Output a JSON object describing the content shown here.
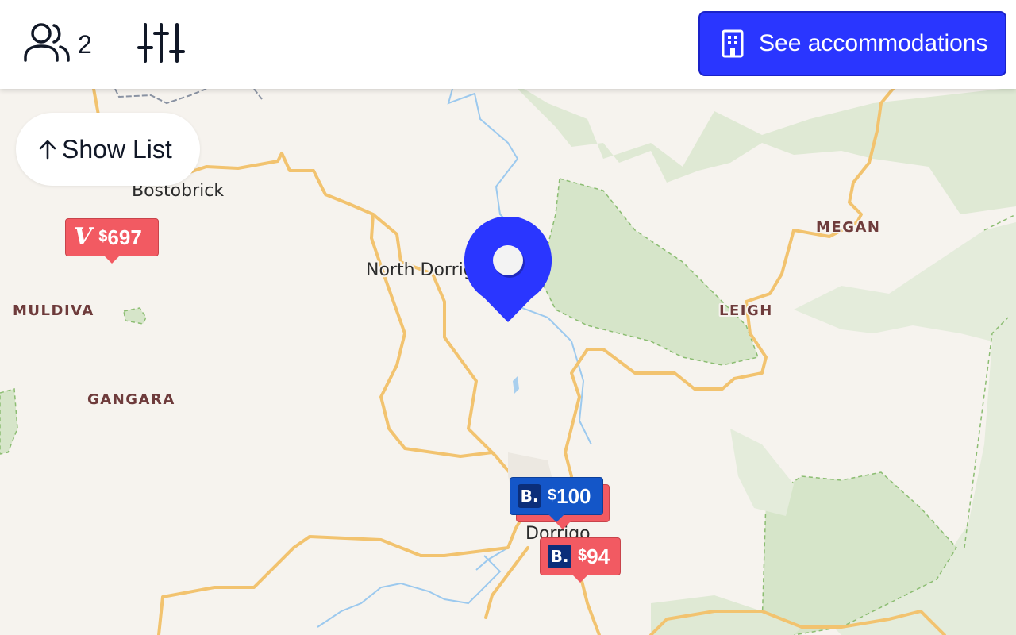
{
  "topbar": {
    "guests_count": "2",
    "cta_label": "See accommodations",
    "colors": {
      "cta": "#2a36ff"
    }
  },
  "show_list": {
    "label": "Show List"
  },
  "map": {
    "places": {
      "bostobrick": "Bostobrick",
      "north_dorrigo": "North Dorrigo",
      "dorrigo": "Dorrigo"
    },
    "localities": {
      "megan": "MEGAN",
      "muldiva": "MULDIVA",
      "leigh": "LEIGH",
      "gangara": "GANGARA"
    }
  },
  "markers": [
    {
      "provider": "vrbo-logo",
      "currency": "$",
      "amount": "697"
    },
    {
      "provider": "booking-logo",
      "currency": "$",
      "amount": "100"
    },
    {
      "provider": "booking-logo",
      "currency": "$",
      "amount": "94"
    }
  ],
  "provider_logos": {
    "booking": "B.",
    "vrbo": "V"
  },
  "colors": {
    "pin": "#2a36ff",
    "marker_red": "#f25a62",
    "marker_blue": "#1456c8"
  }
}
